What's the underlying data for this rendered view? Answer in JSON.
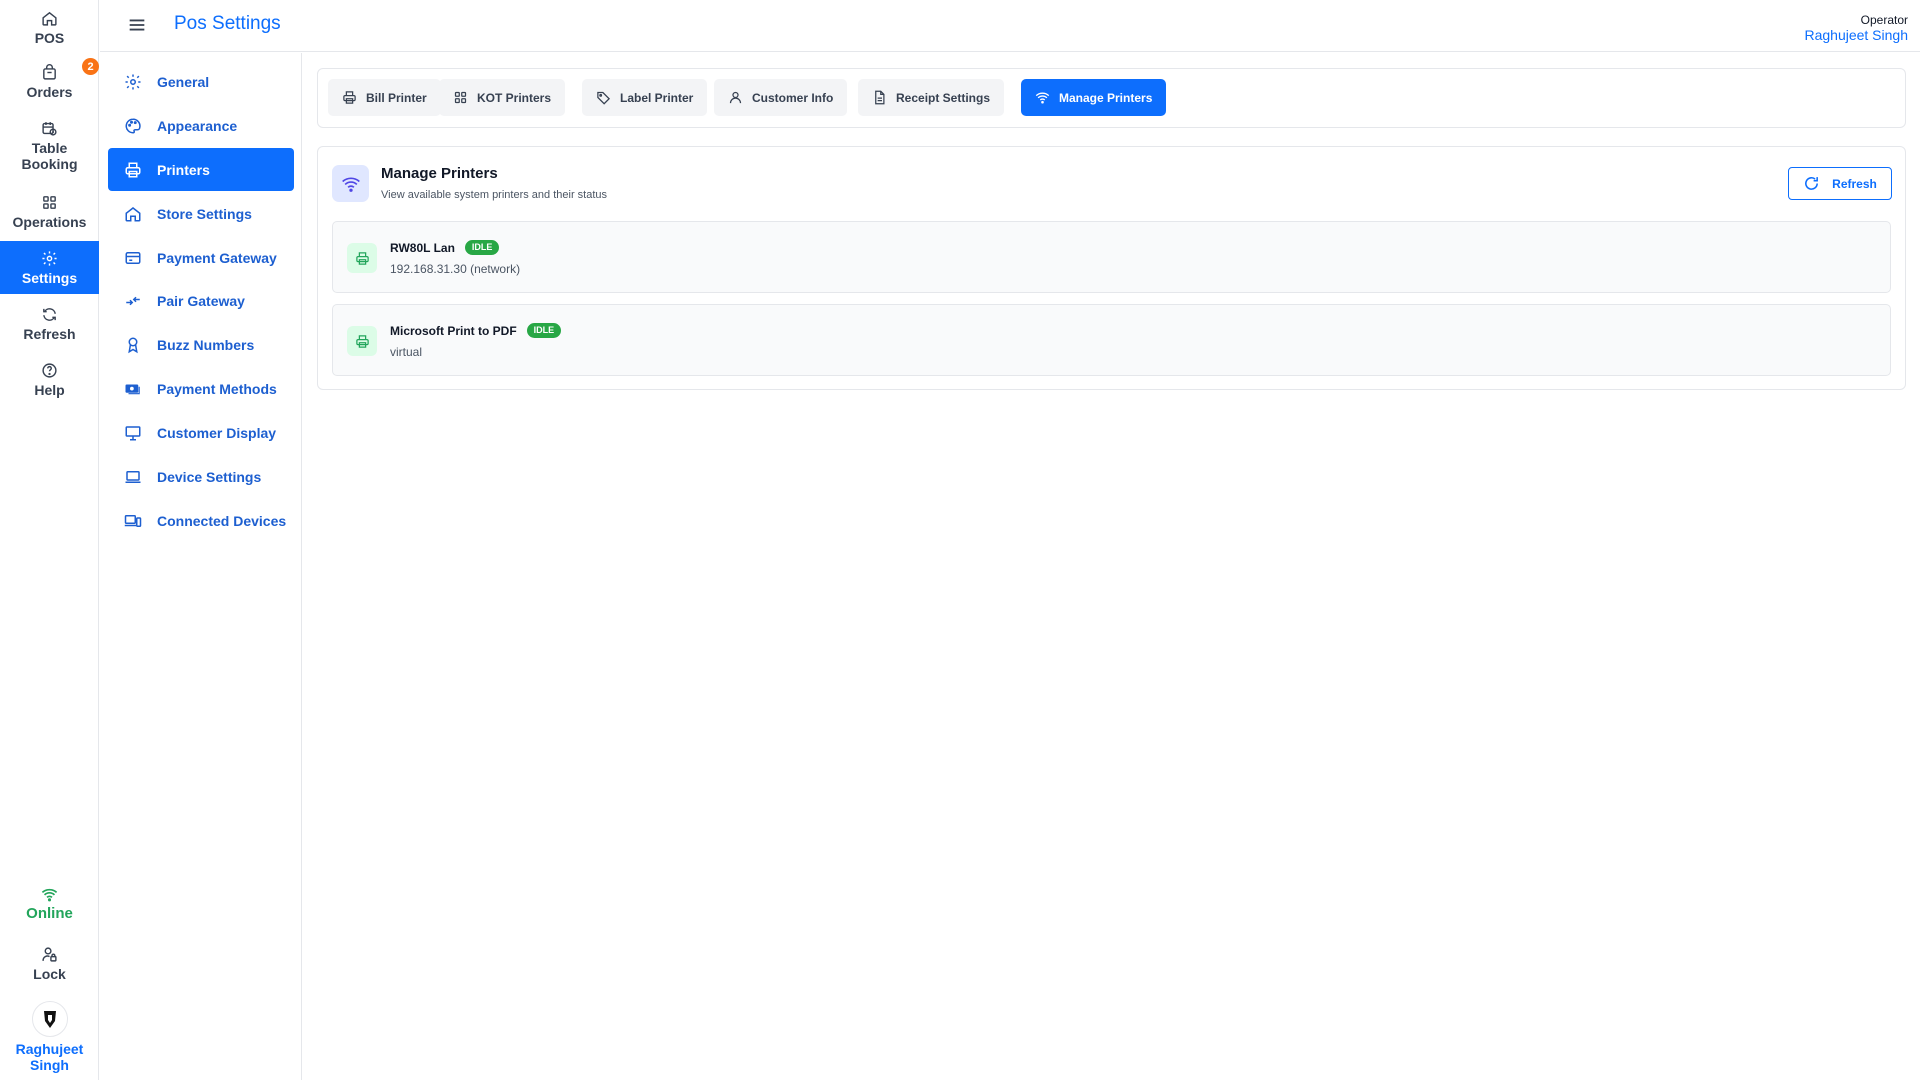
{
  "rail": {
    "items": [
      {
        "label": "POS",
        "icon": "home-icon"
      },
      {
        "label": "Orders",
        "icon": "bag-icon",
        "badge": "2"
      },
      {
        "label": "Table Booking",
        "icon": "calendar-clock-icon"
      },
      {
        "label": "Operations",
        "icon": "grid-icon"
      },
      {
        "label": "Settings",
        "icon": "gear-icon"
      },
      {
        "label": "Refresh",
        "icon": "refresh-icon"
      },
      {
        "label": "Help",
        "icon": "help-icon"
      }
    ],
    "status": "Online",
    "lock": "Lock",
    "user": "Raghujeet Singh"
  },
  "header": {
    "title": "Pos Settings",
    "operator_role": "Operator",
    "operator_name": "Raghujeet Singh"
  },
  "settings_nav": {
    "items": [
      {
        "label": "General",
        "icon": "gear-icon"
      },
      {
        "label": "Appearance",
        "icon": "palette-icon"
      },
      {
        "label": "Printers",
        "icon": "printer-icon"
      },
      {
        "label": "Store Settings",
        "icon": "home-icon"
      },
      {
        "label": "Payment Gateway",
        "icon": "card-icon"
      },
      {
        "label": "Pair Gateway",
        "icon": "pair-arrows-icon"
      },
      {
        "label": "Buzz Numbers",
        "icon": "award-icon"
      },
      {
        "label": "Payment Methods",
        "icon": "cash-icon"
      },
      {
        "label": "Customer Display",
        "icon": "monitor-icon"
      },
      {
        "label": "Device Settings",
        "icon": "laptop-icon"
      },
      {
        "label": "Connected Devices",
        "icon": "devices-icon"
      }
    ]
  },
  "tabs": [
    {
      "label": "Bill Printer",
      "icon": "printer-icon"
    },
    {
      "label": "KOT Printers",
      "icon": "grid-icon"
    },
    {
      "label": "Label Printer",
      "icon": "tag-icon"
    },
    {
      "label": "Customer Info",
      "icon": "user-icon"
    },
    {
      "label": "Receipt Settings",
      "icon": "document-icon"
    },
    {
      "label": "Manage Printers",
      "icon": "wifi-icon"
    }
  ],
  "manage": {
    "title": "Manage Printers",
    "subtitle": "View available system printers and their status",
    "refresh_label": "Refresh",
    "printers": [
      {
        "name": "RW80L Lan",
        "status": "IDLE",
        "detail": "192.168.31.30 (network)"
      },
      {
        "name": "Microsoft Print to PDF",
        "status": "IDLE",
        "detail": "virtual"
      }
    ]
  },
  "colors": {
    "accent": "#0d6efd",
    "online": "#22a55b",
    "badge": "#f97316",
    "idle": "#28a745"
  }
}
